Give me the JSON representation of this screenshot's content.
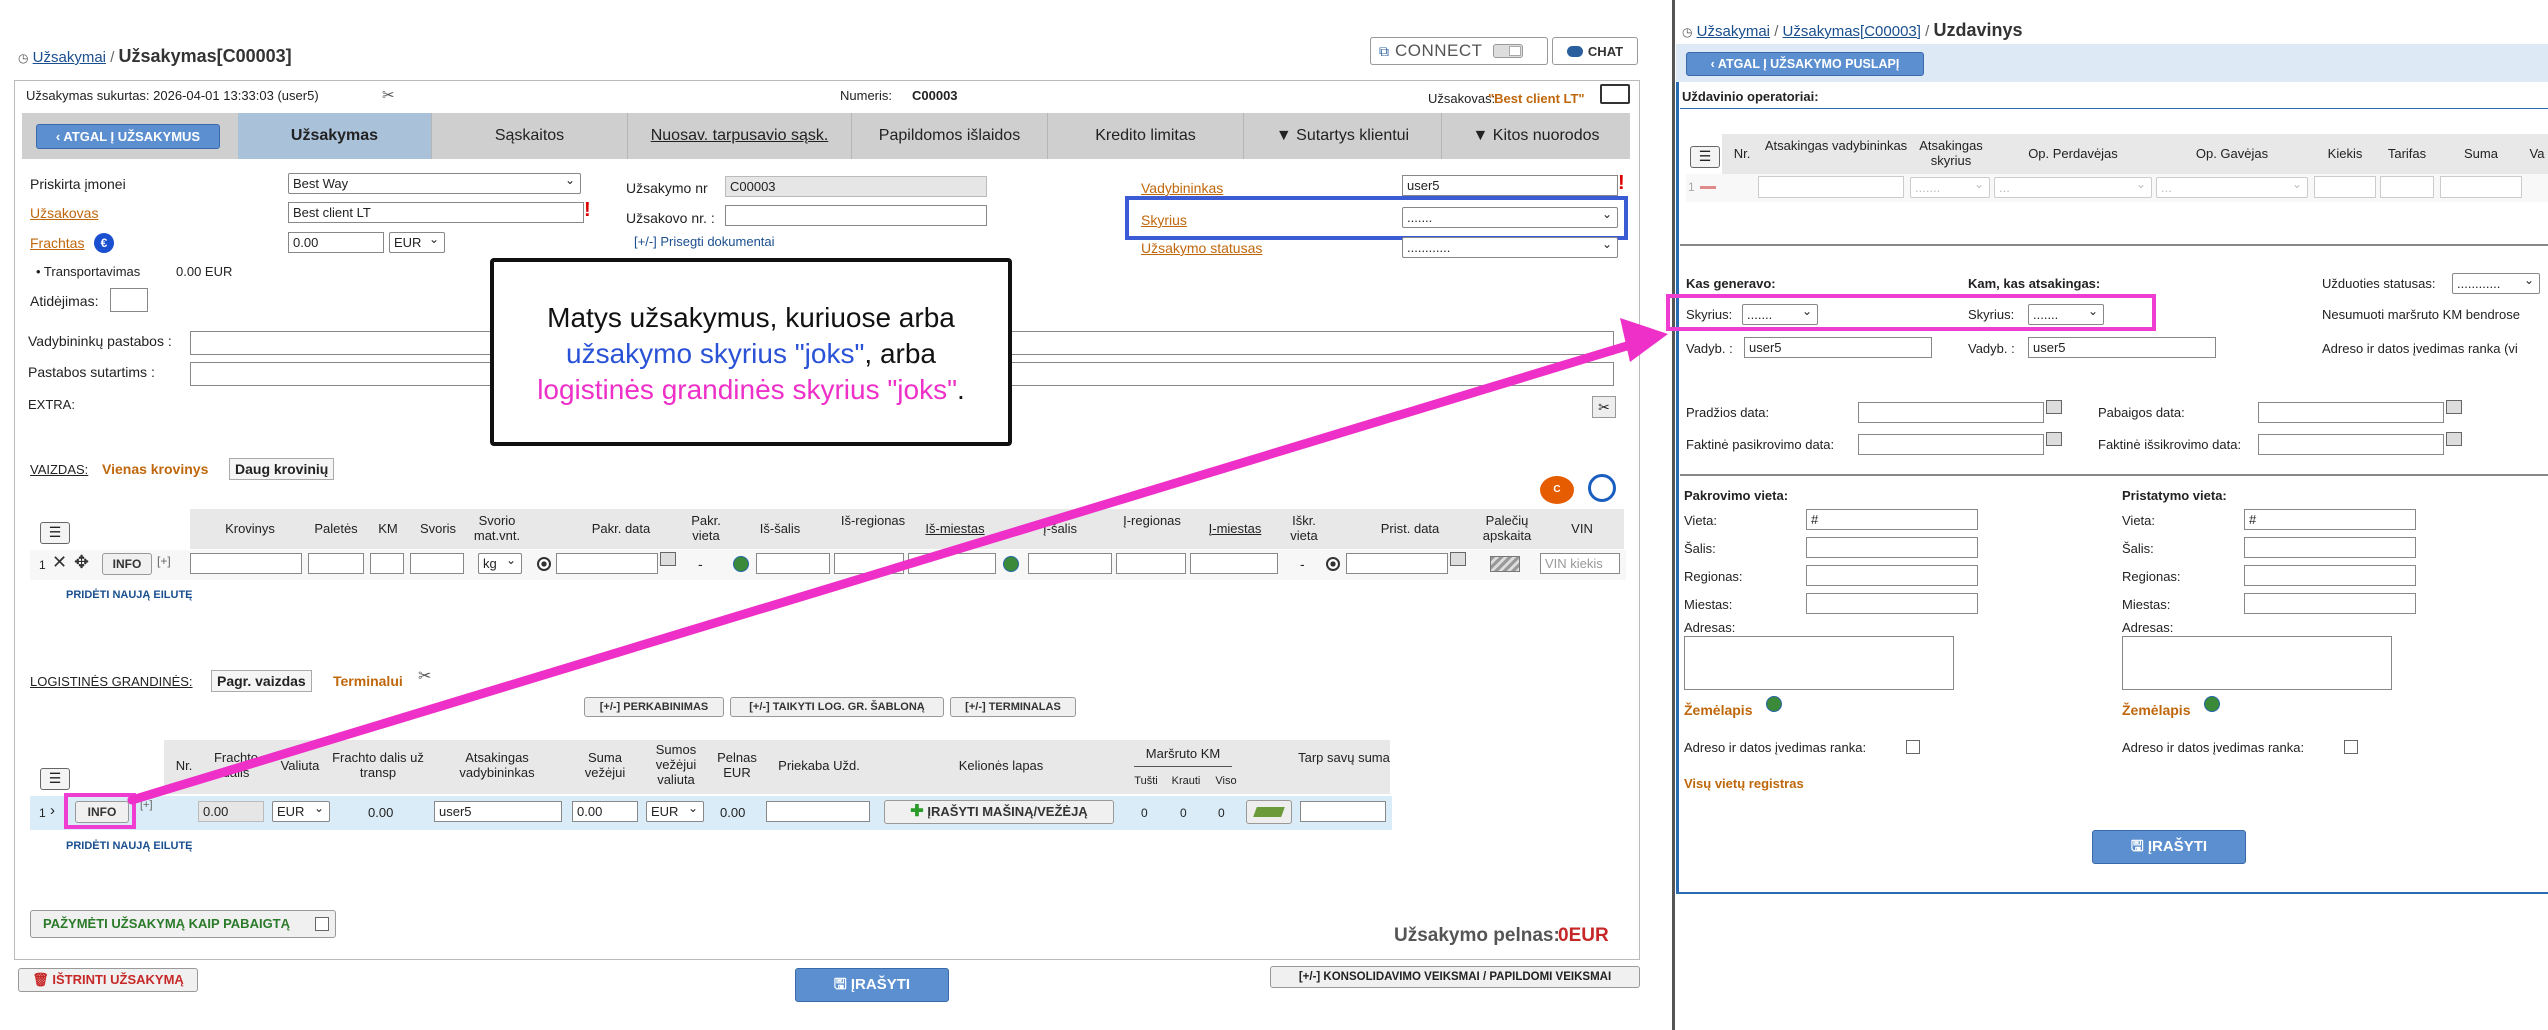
{
  "left": {
    "breadcrumb": {
      "root": "Užsakymai",
      "sep": "/",
      "current": "Užsakymas[C00003]"
    },
    "connect_label": "CONNECT",
    "chat_label": "CHAT",
    "created": "Užsakymas sukurtas: 2026-04-01 13:33:03 (user5)",
    "numeris_label": "Numeris:",
    "numeris_value": "C00003",
    "uzsakovas_label": "Užsakovas:",
    "uzsakovas_value": "\"Best client LT\"",
    "tabs": [
      "Užsakymas",
      "Sąskaitos",
      "Nuosav. tarpusavio sąsk.",
      "Papildomos išlaidos",
      "Kredito limitas",
      "▼ Sutartys klientui",
      "▼ Kitos nuorodos"
    ],
    "back_button": "ATGAL Į UŽSAKYMUS",
    "form": {
      "priskirta_label": "Priskirta įmonei",
      "priskirta_value": "Best Way",
      "uzsakovas_label": "Užsakovas",
      "uzsakovas_value": "Best client LT",
      "frachtas_label": "Frachtas",
      "frachtas_value": "0.00",
      "frachtas_currency": "EUR",
      "transport_label": "• Transportavimas",
      "transport_value": "0.00 EUR",
      "atidejimas_label": "Atidėjimas:",
      "uzsakymo_nr_label": "Užsakymo nr",
      "uzsakymo_nr_value": "C00003",
      "uzsakovo_nr_label": "Užsakovo nr. :",
      "prisegti": "[+/-] Prisegti dokumentai",
      "vadybininkas_label": "Vadybininkas",
      "vadybininkas_value": "user5",
      "skyrius_label": "Skyrius",
      "skyrius_value": ".......",
      "statusas_label": "Užsakymo statusas",
      "statusas_value": "............",
      "vad_pastabos_label": "Vadybininkų pastabos :",
      "pastabos_sut_label": "Pastabos sutartims :",
      "extra_label": "EXTRA:"
    },
    "vaizdas": {
      "label": "VAIZDAS:",
      "vienas": "Vienas krovinys",
      "daug": "Daug krovinių",
      "headers": [
        "Krovinys",
        "Paletės",
        "KM",
        "Svoris",
        "Svorio mat.vnt.",
        "Pakr. data",
        "Pakr. vieta",
        "Iš-šalis",
        "Iš-regionas",
        "Iš-miestas",
        "Į-šalis",
        "Į-regionas",
        "Į-miestas",
        "Iškr. vieta",
        "Prist. data",
        "Palečių apskaita",
        "VIN"
      ],
      "row_num": "1",
      "info_btn": "INFO",
      "plus_btn": "[+]",
      "kg": "kg",
      "dash": "-",
      "vin_placeholder": "VIN kiekis",
      "add_row": "PRIDĖTI NAUJĄ EILUTĘ"
    },
    "log": {
      "label": "LOGISTINĖS GRANDINĖS:",
      "pagr": "Pagr. vaizdas",
      "terminalai": "Terminalui",
      "btn1": "[+/-] PERKABINIMAS",
      "btn2": "[+/-] TAIKYTI LOG. GR. ŠABLONĄ",
      "btn3": "[+/-] TERMINALAS",
      "headers": [
        "Nr.",
        "Frachto dalis",
        "Valiuta",
        "Frachto dalis už transp",
        "Atsakingas vadybininkas",
        "Suma vežėjui",
        "Sumos vežėjui valiuta",
        "Pelnas EUR",
        "Priekaba Užd.",
        "Kelionės lapas",
        "Maršruto KM",
        "Tušti",
        "Krauti",
        "Viso",
        "Tarp savų suma"
      ],
      "row": {
        "num": "1",
        "frachto": "0.00",
        "valiuta": "EUR",
        "frachto_transp": "0.00",
        "vadyb": "user5",
        "suma": "0.00",
        "suma_val": "EUR",
        "pelnas": "0.00",
        "kelione_btn": "ĮRAŠYTI MAŠINĄ/VEŽĖJĄ",
        "tusti": "0",
        "krauti": "0",
        "viso": "0"
      },
      "add_row": "PRIDĖTI NAUJĄ EILUTĘ"
    },
    "pazymeti": "PAŽYMĖTI UŽSAKYMĄ KAIP PABAIGTĄ",
    "pelnas_label": "Užsakymo pelnas:",
    "pelnas_value": "0EUR",
    "istrinti": "IŠTRINTI UŽSAKYMĄ",
    "irasyti": "ĮRAŠYTI",
    "konsolidavimo": "[+/-] KONSOLIDAVIMO VEIKSMAI / PAPILDOMI VEIKSMAI"
  },
  "callout": {
    "line1": "Matys užsakymus, kuriuose arba",
    "line2_blue": "užsakymo skyrius \"joks\"",
    "line2_rest": ", arba",
    "line3_pink": "logistinės grandinės skyrius \"joks\"",
    "line3_rest": "."
  },
  "right": {
    "breadcrumb": {
      "root": "Užsakymai",
      "sep1": "/",
      "mid": "Užsakymas[C00003]",
      "sep2": "/",
      "current": "Uzdavinys"
    },
    "back_button": "ATGAL Į UŽSAKYMO PUSLAPĮ",
    "operatoriai_label": "Uždavinio operatoriai:",
    "headers": [
      "Nr.",
      "Atsakingas vadybininkas",
      "Atsakingas skyrius",
      "Op. Perdavėjas",
      "Op. Gavėjas",
      "Kiekis",
      "Tarifas",
      "Suma",
      "Va"
    ],
    "row_num": "1",
    "kas_generavo": "Kas generavo:",
    "kam_atsakingas": "Kam, kas atsakingas:",
    "uzd_statusas": "Užduoties statusas:",
    "uzd_statusas_value": "............",
    "skyrius_label": "Skyrius:",
    "skyrius_value": ".......",
    "vadyb_label": "Vadyb. :",
    "vadyb_value": "user5",
    "nesumuoti": "Nesumuoti maršruto KM bendrose",
    "adreso_rank": "Adreso ir datos įvedimas ranka (vi",
    "pradzios": "Pradžios data:",
    "pabaigos": "Pabaigos data:",
    "faktine_pask": "Faktinė pasikrovimo data:",
    "faktine_isk": "Faktinė išsikrovimo data:",
    "pakrovimo": "Pakrovimo vieta:",
    "pristatymo": "Pristatymo vieta:",
    "vieta": "Vieta:",
    "vieta_value": "#",
    "salis": "Šalis:",
    "regionas": "Regionas:",
    "miestas": "Miestas:",
    "adresas": "Adresas:",
    "zemelapis": "Žemėlapis",
    "adreso_ivedimas": "Adreso ir datos įvedimas ranka:",
    "visu_vietu": "Visų vietų registras",
    "irasyti": "ĮRAŠYTI"
  }
}
